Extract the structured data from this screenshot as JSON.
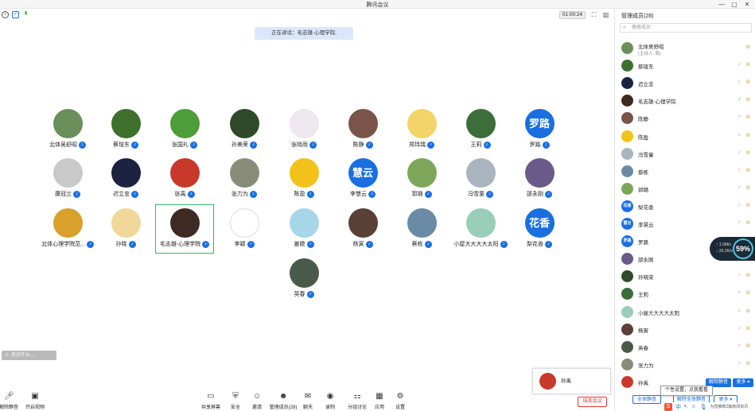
{
  "window": {
    "title": "腾讯会议",
    "min": "—",
    "max": "▢",
    "close": "✕"
  },
  "timer": "01:00:24",
  "speaking": "正在讲话：毛志雄-心理学院;",
  "colors": {
    "accent": "#1a6fe0",
    "active_border": "#34b46a",
    "end_red": "#e33"
  },
  "participants": [
    {
      "name": "北体吴舒昭",
      "av": "#6b8f5a"
    },
    {
      "name": "蔡瑄东",
      "av": "#3f6f2c"
    },
    {
      "name": "张国礼",
      "av": "#4d9d3a"
    },
    {
      "name": "孙美荣",
      "av": "#2e4a2a"
    },
    {
      "name": "张晓雨",
      "av": "#efe7ef"
    },
    {
      "name": "陈静",
      "av": "#7a5448"
    },
    {
      "name": "郑玮瑞",
      "av": "#f4d46a"
    },
    {
      "name": "王莉",
      "av": "#3b6e3a"
    },
    {
      "name": "罗路",
      "av": "#1a6fe0",
      "text": "罗路"
    },
    {
      "name": "康冠兰",
      "av": "#c9c9c9"
    },
    {
      "name": "迟立忠",
      "av": "#1c2340"
    },
    {
      "name": "张禹",
      "av": "#c8382b"
    },
    {
      "name": "张力为",
      "av": "#8a8c7a"
    },
    {
      "name": "陈盈",
      "av": "#f2c21b"
    },
    {
      "name": "李慧云",
      "av": "#1a6fe0",
      "text": "慧云"
    },
    {
      "name": "郭璐",
      "av": "#7da65a"
    },
    {
      "name": "冯雪童",
      "av": "#a9b4bf"
    },
    {
      "name": "邵永刚",
      "av": "#6a5a8a"
    },
    {
      "name": "北体心理学院范...",
      "av": "#d9a02a"
    },
    {
      "name": "孙晓",
      "av": "#efd89a"
    },
    {
      "name": "毛志雄-心理学院",
      "av": "#3d2a22"
    },
    {
      "name": "李颖",
      "av": "#ffffff"
    },
    {
      "name": "姜婕",
      "av": "#a7d6e8"
    },
    {
      "name": "杨寅",
      "av": "#5a4036"
    },
    {
      "name": "蔡栋",
      "av": "#6b8aa6"
    },
    {
      "name": "小屋大大大大太阳",
      "av": "#9acdb8"
    },
    {
      "name": "梨花香",
      "av": "#1a6fe0",
      "text": "花香"
    },
    {
      "name": "英春",
      "av": "#4a5a4a"
    }
  ],
  "chat_hint": "说点什么...",
  "self_card_name": "孙禹",
  "end_meeting": "结束会议",
  "toolbar": {
    "unmute": "解除静音",
    "start_video": "开启视频",
    "share": "共享屏幕",
    "security": "安全",
    "invite": "邀请",
    "manage": "管理成员(28)",
    "chat": "聊天",
    "record": "录制",
    "breakout": "分组讨论",
    "apps": "应用",
    "settings": "设置"
  },
  "panel": {
    "title": "管理成员(28)",
    "search_placeholder": "搜索成员",
    "host_sub": "(主持人, 我)",
    "members": [
      {
        "name": "北体吴舒昭",
        "av": "#6b8f5a"
      },
      {
        "name": "蔡瑄东",
        "av": "#3f6f2c"
      },
      {
        "name": "迟立忠",
        "av": "#1c2340"
      },
      {
        "name": "毛志雄-心理学院",
        "av": "#3d2a22"
      },
      {
        "name": "陈静",
        "av": "#7a5448"
      },
      {
        "name": "陈盈",
        "av": "#f2c21b"
      },
      {
        "name": "冯雪童",
        "av": "#a9b4bf"
      },
      {
        "name": "蔡栋",
        "av": "#6b8aa6"
      },
      {
        "name": "郭璐",
        "av": "#7da65a"
      },
      {
        "name": "梨花香",
        "av": "#1a6fe0",
        "text": "花香"
      },
      {
        "name": "李慧云",
        "av": "#1a6fe0",
        "text": "慧云"
      },
      {
        "name": "罗路",
        "av": "#1a6fe0",
        "text": "罗路"
      },
      {
        "name": "邵永刚",
        "av": "#6a5a8a"
      },
      {
        "name": "孙晓荣",
        "av": "#2e4a2a"
      },
      {
        "name": "王莉",
        "av": "#3b6e3a"
      },
      {
        "name": "小屋大大大大太阳",
        "av": "#9acdb8"
      },
      {
        "name": "杨寅",
        "av": "#5a4036"
      },
      {
        "name": "英春",
        "av": "#4a5a4a"
      },
      {
        "name": "张力为",
        "av": "#8a8c7a"
      },
      {
        "name": "孙禹",
        "av": "#c8382b"
      }
    ],
    "mute_all": "全体静音",
    "unmute_all": "解除全体静音",
    "more": "更多",
    "unmute_btn": "解除静音",
    "more_btn": "更多",
    "tooltip": "个性设置，点我看看"
  },
  "speed": {
    "pct": "59%",
    "up": "1.0M/s",
    "down": "20.2K/s"
  },
  "ime": {
    "logo": "S",
    "lang": "中"
  },
  "ime_notice": "为您推荐2篇新闻资讯"
}
